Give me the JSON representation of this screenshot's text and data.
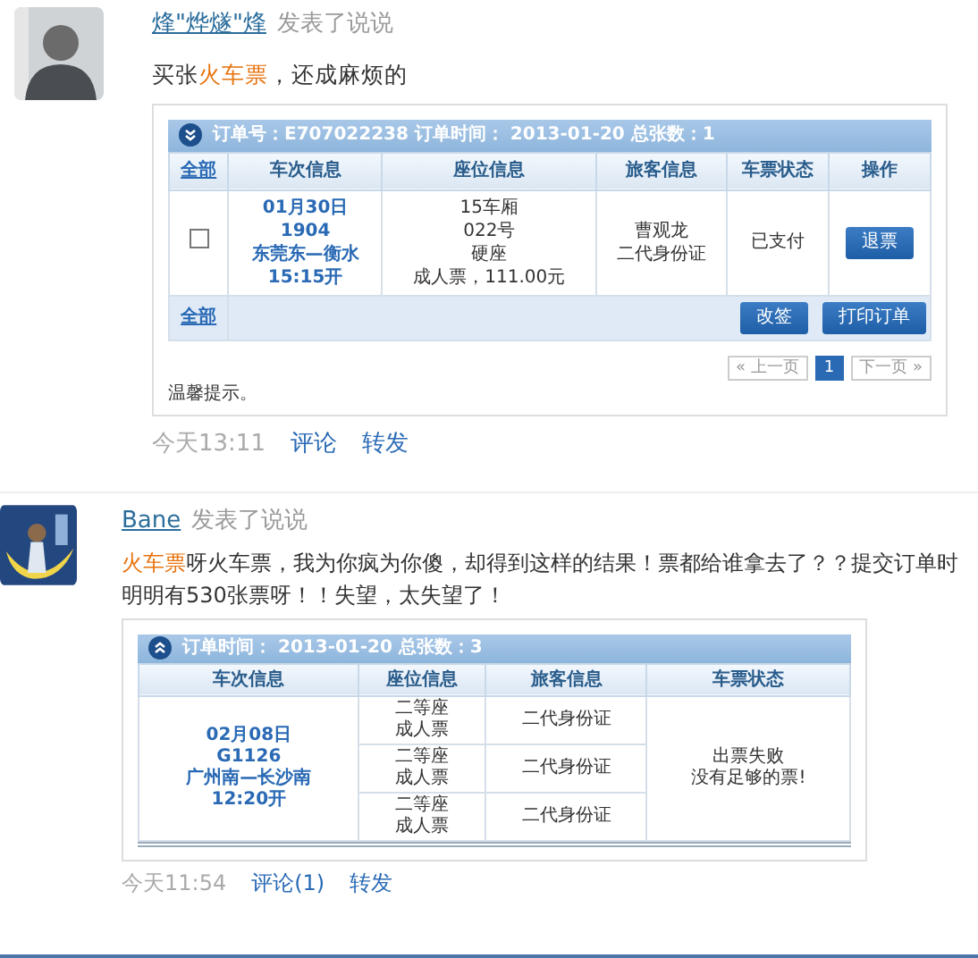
{
  "posts": [
    {
      "author": "烽\"烨燧\"烽",
      "action": "发表了说说",
      "text": [
        {
          "text": "买张",
          "highlight": false
        },
        {
          "text": "火车票",
          "highlight": true
        },
        {
          "text": "，还成麻烦的",
          "highlight": false
        }
      ],
      "order": {
        "expanded": true,
        "header": "订单号：E707022238  订单时间： 2013-01-20  总张数：1",
        "columns": [
          {
            "label": "全部",
            "kind": "link"
          },
          {
            "label": "车次信息",
            "kind": "text"
          },
          {
            "label": "座位信息",
            "kind": "text"
          },
          {
            "label": "旅客信息",
            "kind": "text"
          },
          {
            "label": "车票状态",
            "kind": "text"
          },
          {
            "label": "操作",
            "kind": "text"
          }
        ],
        "rows": [
          {
            "checked": false,
            "train": [
              "01月30日",
              "1904",
              "东莞东—衡水",
              "15:15开"
            ],
            "seats": [
              {
                "lines": [
                  "15车厢",
                  "022号",
                  "硬座",
                  "成人票，111.00元"
                ],
                "passenger": [
                  "曹观龙",
                  "二代身份证"
                ]
              }
            ],
            "status": [
              "已支付"
            ],
            "action": "退票"
          }
        ],
        "footer": {
          "select_all": "全部",
          "buttons": [
            "改签",
            "打印订单"
          ]
        },
        "pagination": [
          {
            "label": "« 上一页",
            "selected": false
          },
          {
            "label": "1",
            "selected": true
          },
          {
            "label": "下一页 »",
            "selected": false
          }
        ],
        "tip": "温馨提示。"
      },
      "time": "今天13:11",
      "links": [
        "评论",
        "转发"
      ]
    },
    {
      "author": "Bane",
      "action": "发表了说说",
      "text": [
        {
          "text": "火车票",
          "highlight": true
        },
        {
          "text": "呀火车票，我为你疯为你傻，却得到这样的结果！票都给谁拿去了？？提交订单时明明有530张票呀！！失望，太失望了！",
          "highlight": false
        }
      ],
      "order": {
        "expanded": false,
        "header": "订单时间： 2013-01-20  总张数：3",
        "columns": [
          {
            "label": "车次信息",
            "kind": "text"
          },
          {
            "label": "座位信息",
            "kind": "text"
          },
          {
            "label": "旅客信息",
            "kind": "text"
          },
          {
            "label": "车票状态",
            "kind": "text"
          }
        ],
        "rows": [
          {
            "train": [
              "02月08日",
              "G1126",
              "广州南—长沙南",
              "12:20开"
            ],
            "seats": [
              {
                "lines": [
                  "二等座",
                  "成人票"
                ],
                "passenger": [
                  "二代身份证"
                ]
              },
              {
                "lines": [
                  "二等座",
                  "成人票"
                ],
                "passenger": [
                  "二代身份证"
                ]
              },
              {
                "lines": [
                  "二等座",
                  "成人票"
                ],
                "passenger": [
                  "二代身份证"
                ]
              }
            ],
            "status": [
              "出票失败",
              "没有足够的票!"
            ]
          }
        ]
      },
      "time": "今天11:54",
      "links": [
        "评论(1)",
        "转发"
      ]
    }
  ]
}
